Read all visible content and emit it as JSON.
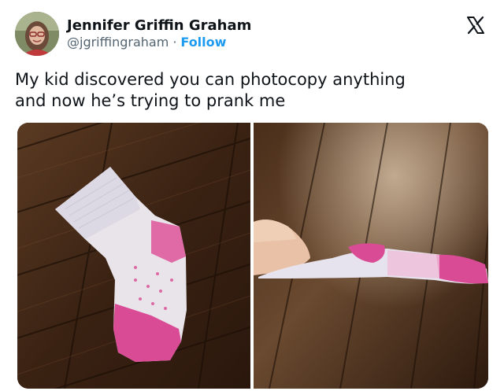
{
  "author": {
    "name": "Jennifer Griffin Graham",
    "handle": "@jgriffingraham",
    "separator": "·",
    "follow_label": "Follow"
  },
  "tweet": {
    "text": "My kid discovered you can photocopy anything\nand now he’s trying to prank me"
  },
  "icons": {
    "brand": "x-logo-icon"
  },
  "media": {
    "images": [
      {
        "name": "real-sock-photo",
        "depicts": "pink and white sock on wooden floor"
      },
      {
        "name": "photocopied-sock-photo",
        "depicts": "hand holding flat paper photocopy of sock"
      }
    ]
  },
  "colors": {
    "link": "#1d9bf0",
    "text": "#0f1419",
    "secondary": "#536471",
    "floor": "#3a2414",
    "sock_pink": "#d94c95"
  }
}
